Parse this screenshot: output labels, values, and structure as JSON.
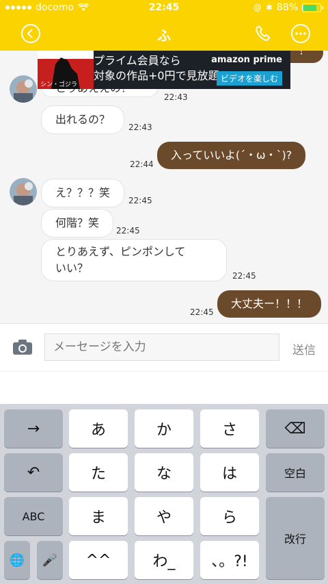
{
  "status_bar": {
    "carrier": "docomo",
    "time": "22:45",
    "battery": "88%",
    "battery_level": 0.88
  },
  "header": {
    "title": "ふ"
  },
  "ad": {
    "poster_text": "シン・ゴジラ",
    "line1": "プライム会員なら",
    "line2": "対象の作品+0円で見放題!",
    "brand": "amazon prime",
    "cta": "ビデオを楽しむ"
  },
  "messages": [
    {
      "direction": "out",
      "text": "！",
      "time": ""
    },
    {
      "direction": "in",
      "text": "とりあええの？",
      "time": "22:43"
    },
    {
      "direction": "in",
      "text": "出れるの？",
      "time": "22:43"
    },
    {
      "direction": "out",
      "text": "入っていいよ(´・ω・`)?",
      "time": "22:44"
    },
    {
      "direction": "in",
      "text": "え？？？笑",
      "time": "22:45"
    },
    {
      "direction": "in",
      "text": "何階？笑",
      "time": "22:45"
    },
    {
      "direction": "in",
      "text": "とりあえず、ピンポンして\nいい？",
      "time": "22:45"
    },
    {
      "direction": "out",
      "text": "大丈夫ー！！！",
      "time": "22:45"
    }
  ],
  "composer": {
    "placeholder": "メーセージを入力",
    "send_label": "送信"
  },
  "keyboard": {
    "row1": [
      "→",
      "あ",
      "か",
      "さ",
      "⌫"
    ],
    "row2": [
      "↶",
      "た",
      "な",
      "は",
      "空白"
    ],
    "row3": [
      "ABC",
      "ま",
      "や",
      "ら",
      "改行"
    ],
    "row4": [
      "🌐",
      "🎤",
      "^^",
      "わ_",
      "、。?!"
    ]
  }
}
